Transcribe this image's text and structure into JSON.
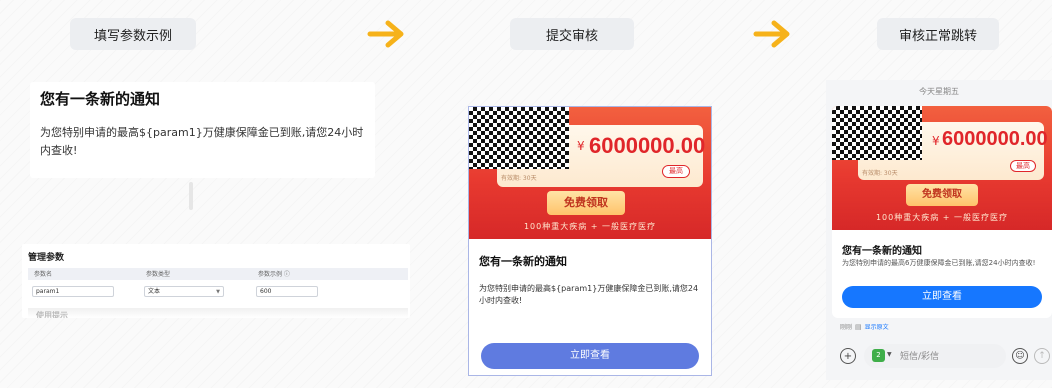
{
  "steps": [
    {
      "label": "填写参数示例"
    },
    {
      "label": "提交审核"
    },
    {
      "label": "审核正常跳转"
    }
  ],
  "colors": {
    "arrow": "#f6b21a",
    "primary_blue": "#5f7be0",
    "bright_blue": "#1677ff",
    "banner_red": "#e83a30"
  },
  "notification": {
    "title": "您有一条新的通知",
    "body": "为您特别申请的最高${param1}万健康保障金已到账,请您24小时内查收!"
  },
  "params": {
    "section_title": "管理参数",
    "headers": [
      "参数名",
      "参数类型",
      "参数示例 ⓘ"
    ],
    "row": {
      "name": "param1",
      "type": "文本",
      "example": "600"
    },
    "next_section": "使用提示"
  },
  "banner": {
    "currency": "¥",
    "amount": "6000000.00",
    "badge": "最高",
    "validity": "有效期: 30天",
    "claim": "免费领取",
    "footer": "100种重大疾病 + 一般医疗医疗"
  },
  "phone2": {
    "title": "您有一条新的通知",
    "body": "为您特别申请的最高${param1}万健康保障金已到账,请您24小时内查收!",
    "button": "立即查看"
  },
  "phone3": {
    "date": "今天星期五",
    "title": "您有一条新的通知",
    "body": "为您特别申请的最高6万健康保障金已到账,请您24小时内查收!",
    "button": "立即查看",
    "meta_prefix": "刚刚",
    "meta_link": "显示原文",
    "input_placeholder": "短信/彩信"
  }
}
